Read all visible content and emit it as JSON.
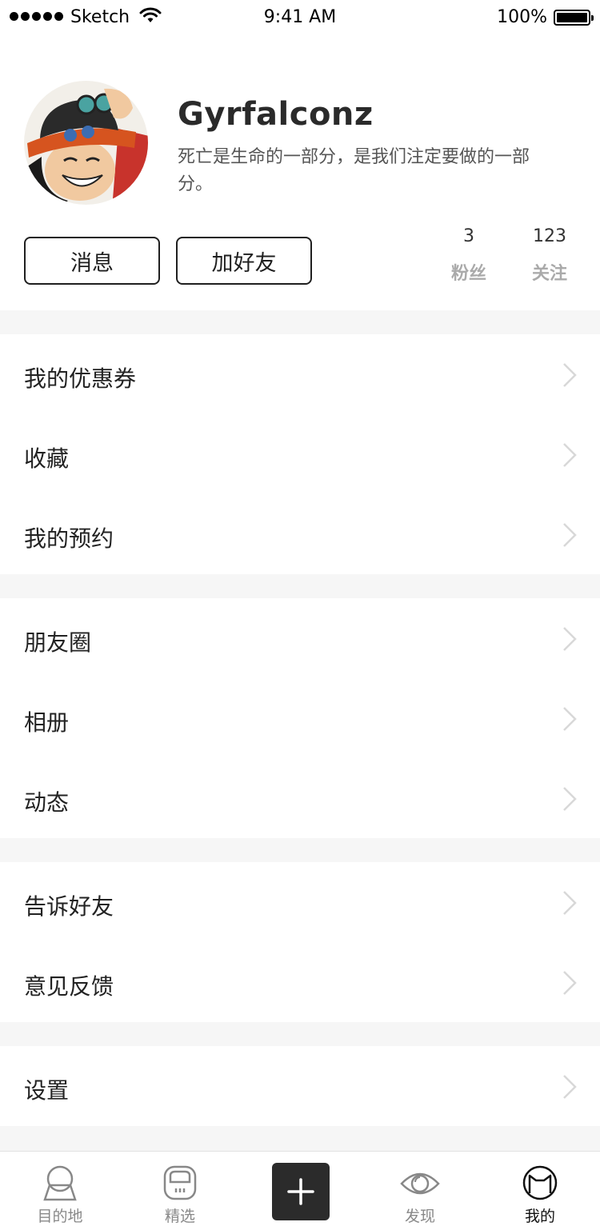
{
  "status_bar": {
    "carrier": "Sketch",
    "time": "9:41 AM",
    "battery": "100%"
  },
  "profile": {
    "username": "Gyrfalconz",
    "bio": "死亡是生命的一部分，是我们注定要做的一部分。",
    "message_button": "消息",
    "add_friend_button": "加好友",
    "stats": [
      {
        "count": "3",
        "label": "粉丝"
      },
      {
        "count": "123",
        "label": "关注"
      }
    ]
  },
  "menu": {
    "group1": [
      "我的优惠券",
      "收藏",
      "我的预约"
    ],
    "group2": [
      "朋友圈",
      "相册",
      "动态"
    ],
    "group3": [
      "告诉好友",
      "意见反馈"
    ],
    "group4": [
      "设置"
    ]
  },
  "tabbar": {
    "tabs": [
      {
        "label": "目的地",
        "icon": "destination-icon"
      },
      {
        "label": "精选",
        "icon": "featured-icon"
      },
      {
        "label": "",
        "icon": "plus-icon"
      },
      {
        "label": "发现",
        "icon": "eye-icon"
      },
      {
        "label": "我的",
        "icon": "cat-icon"
      }
    ],
    "active_tab": "我的"
  },
  "colors": {
    "divider": "#f6f6f6",
    "plus_button": "#2b2b2b",
    "inactive_tab": "#888888",
    "stat_label": "#aaaaaa"
  }
}
